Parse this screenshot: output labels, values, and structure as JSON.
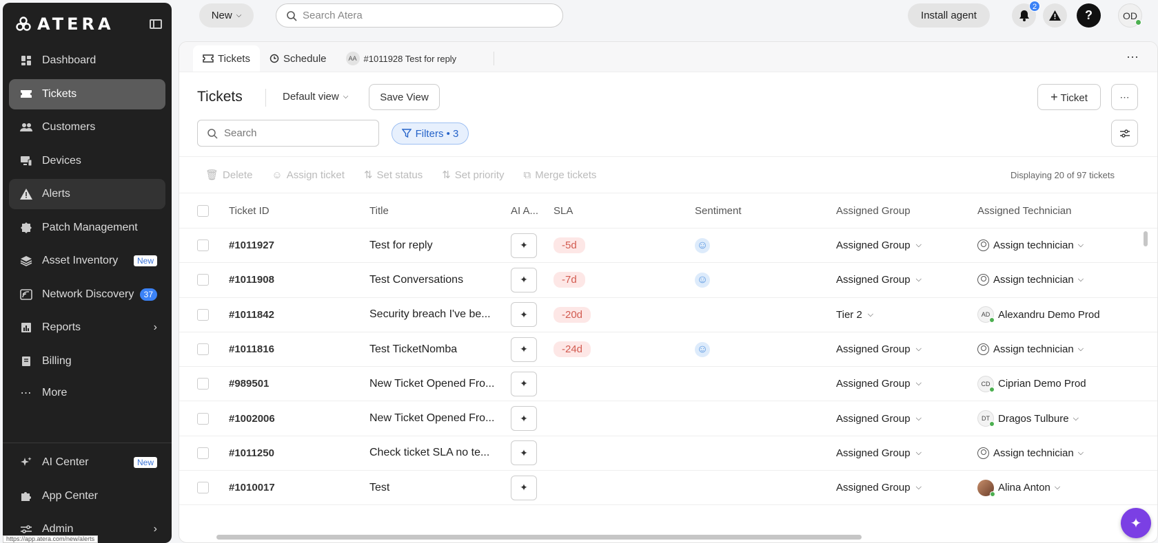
{
  "brand": {
    "name": "ATERA"
  },
  "sidebar": {
    "items": [
      {
        "label": "Dashboard",
        "icon": "dashboard-icon"
      },
      {
        "label": "Tickets",
        "icon": "ticket-icon",
        "state": "active"
      },
      {
        "label": "Customers",
        "icon": "customers-icon"
      },
      {
        "label": "Devices",
        "icon": "devices-icon"
      },
      {
        "label": "Alerts",
        "icon": "alert-icon",
        "state": "hover"
      },
      {
        "label": "Patch Management",
        "icon": "patch-icon"
      },
      {
        "label": "Asset Inventory",
        "icon": "layers-icon",
        "badge": "New"
      },
      {
        "label": "Network Discovery",
        "icon": "network-icon",
        "count": "37"
      },
      {
        "label": "Reports",
        "icon": "reports-icon"
      },
      {
        "label": "Billing",
        "icon": "billing-icon"
      },
      {
        "label": "More",
        "icon": "more-dots-icon"
      }
    ],
    "bottom_items": [
      {
        "label": "AI Center",
        "icon": "sparkle-icon",
        "badge": "New"
      },
      {
        "label": "App Center",
        "icon": "puzzle-icon"
      },
      {
        "label": "Admin",
        "icon": "sliders-icon"
      }
    ],
    "status_url": "https://app.atera.com/new/alerts"
  },
  "topbar": {
    "new_label": "New",
    "search_placeholder": "Search Atera",
    "install_label": "Install agent",
    "notifications_count": "2",
    "help_label": "?",
    "user_initials": "OD"
  },
  "tabs": [
    {
      "label": "Tickets",
      "icon": "ticket-icon",
      "active": true
    },
    {
      "label": "Schedule",
      "icon": "schedule-icon"
    },
    {
      "label": "#1011928 Test for reply",
      "avatar": "AA"
    }
  ],
  "header": {
    "title": "Tickets",
    "view": "Default view",
    "save_view": "Save View",
    "add_ticket": "Ticket"
  },
  "filters": {
    "search_placeholder": "Search",
    "chip": "Filters • 3"
  },
  "actions": {
    "delete": "Delete",
    "assign": "Assign ticket",
    "status": "Set status",
    "priority": "Set priority",
    "merge": "Merge tickets",
    "displaying": "Displaying 20 of 97 tickets"
  },
  "table": {
    "columns": [
      "Ticket ID",
      "Title",
      "AI A...",
      "SLA",
      "Sentiment",
      "Assigned Group",
      "Assigned Technician"
    ],
    "rows": [
      {
        "id": "#1011927",
        "title": "Test for reply",
        "sla": "-5d",
        "sentiment": true,
        "group": "Assigned Group",
        "tech": "Assign technician",
        "tech_type": "icon"
      },
      {
        "id": "#1011908",
        "title": "Test Conversations",
        "sla": "-7d",
        "sentiment": true,
        "group": "Assigned Group",
        "tech": "Assign technician",
        "tech_type": "icon"
      },
      {
        "id": "#1011842",
        "title": "Security breach I've be...",
        "sla": "-20d",
        "sentiment": false,
        "group": "Tier 2",
        "tech": "Alexandru Demo Prod",
        "tech_type": "avatar",
        "initials": "AD"
      },
      {
        "id": "#1011816",
        "title": "Test TicketNomba",
        "sla": "-24d",
        "sentiment": true,
        "group": "Assigned Group",
        "tech": "Assign technician",
        "tech_type": "icon"
      },
      {
        "id": "#989501",
        "title": "New Ticket Opened Fro...",
        "sla": "",
        "sentiment": false,
        "group": "Assigned Group",
        "tech": "Ciprian Demo Prod",
        "tech_type": "avatar",
        "initials": "CD"
      },
      {
        "id": "#1002006",
        "title": "New Ticket Opened Fro...",
        "sla": "",
        "sentiment": false,
        "group": "Assigned Group",
        "tech": "Dragos Tulbure",
        "tech_type": "avatar",
        "initials": "DT",
        "chev": true
      },
      {
        "id": "#1011250",
        "title": "Check ticket SLA no te...",
        "sla": "",
        "sentiment": false,
        "group": "Assigned Group",
        "tech": "Assign technician",
        "tech_type": "icon"
      },
      {
        "id": "#1010017",
        "title": "Test",
        "sla": "",
        "sentiment": false,
        "group": "Assigned Group",
        "tech": "Alina Anton",
        "tech_type": "photo",
        "initials": "",
        "chev": true
      }
    ]
  },
  "colors": {
    "sidebar_bg": "#202020",
    "accent": "#3b82f6",
    "sla_bg": "#fde7e6",
    "sla_text": "#d25b50",
    "fab": "#7b3fe4"
  }
}
